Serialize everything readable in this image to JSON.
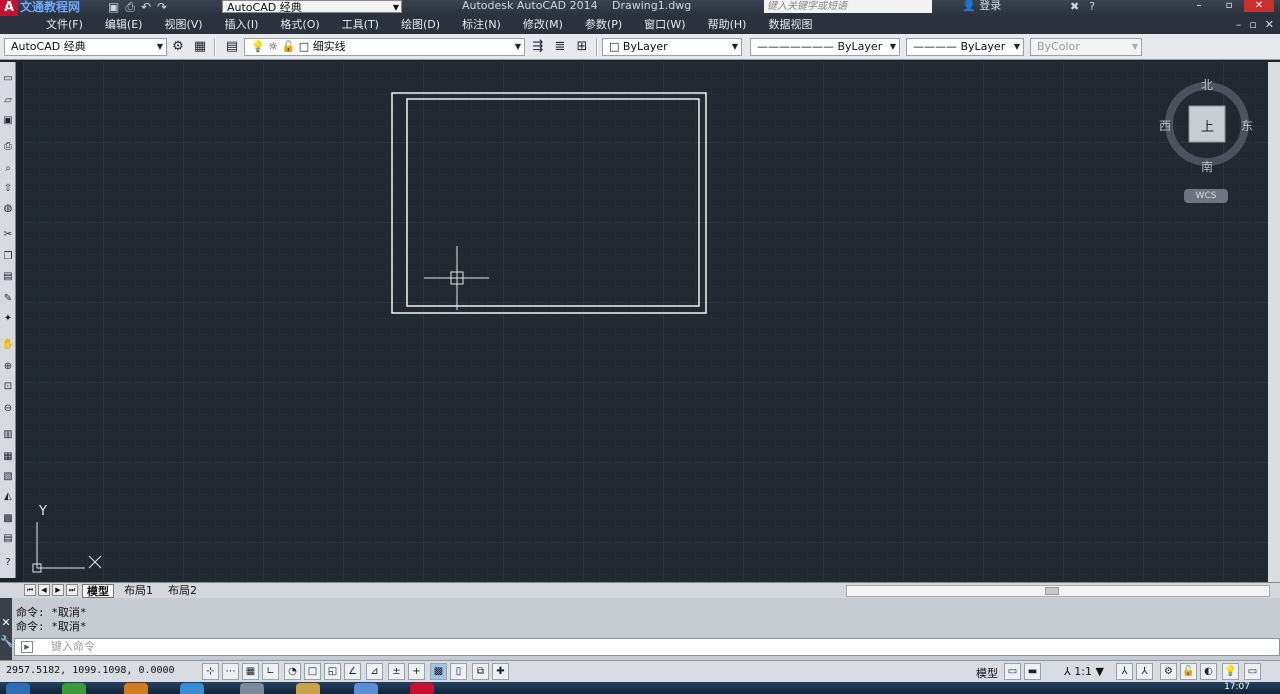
{
  "titlebar": {
    "logo": "A",
    "watermark": "文通教程网",
    "workspace": "AutoCAD 经典",
    "app_title": "Autodesk AutoCAD 2014",
    "doc_title": "Drawing1.dwg",
    "search_placeholder": "键入关键字或短语",
    "login": "登录"
  },
  "menubar": {
    "items": [
      "文件(F)",
      "编辑(E)",
      "视图(V)",
      "插入(I)",
      "格式(O)",
      "工具(T)",
      "绘图(D)",
      "标注(N)",
      "修改(M)",
      "参数(P)",
      "窗口(W)",
      "帮助(H)",
      "数据视图"
    ]
  },
  "toolbar": {
    "workspace_combo": "AutoCAD 经典",
    "layer_combo": "细实线",
    "color_combo": "ByLayer",
    "linetype_combo": "ByLayer",
    "lineweight_combo": "ByLayer",
    "plotstyle_combo": "ByColor"
  },
  "viewcube": {
    "north": "北",
    "south": "南",
    "east": "东",
    "west": "西",
    "face": "上",
    "wcs": "WCS"
  },
  "ucs": {
    "y_label": "Y",
    "x_label": "X"
  },
  "layout_tabs": [
    "模型",
    "布局1",
    "布局2"
  ],
  "active_tab": "模型",
  "command": {
    "history": [
      "命令: *取消*",
      "命令: *取消*"
    ],
    "placeholder": "键入命令"
  },
  "status": {
    "coordinates": "2957.5182, 1099.1098, 0.0000",
    "model": "模型",
    "scale": "1:1"
  },
  "taskbar": {
    "time": "17:07"
  },
  "colors": {
    "canvas": "#212830",
    "drawing_lines": "#ffffff",
    "menubar": "#2b323c"
  }
}
